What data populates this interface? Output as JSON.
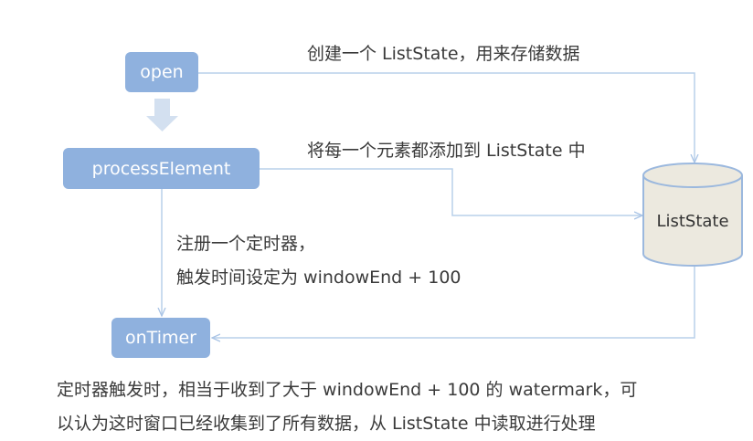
{
  "nodes": {
    "open": "open",
    "process": "processElement",
    "ontimer": "onTimer",
    "store": "ListState"
  },
  "edges": {
    "open_to_store": "创建一个 ListState，用来存储数据",
    "process_to_store": "将每一个元素都添加到 ListState 中",
    "process_to_ontimer_line1": "注册一个定时器，",
    "process_to_ontimer_line2": "触发时间设定为 windowEnd + 100"
  },
  "caption": {
    "line1": "定时器触发时，相当于收到了大于 windowEnd + 100 的 watermark，可",
    "line2": "以认为这时窗口已经收集到了所有数据，从 ListState 中读取进行处理"
  },
  "colors": {
    "box": "#8fb1de",
    "arrow": "#b9d0ea",
    "cylinder_fill": "#ece9df",
    "cylinder_stroke": "#9bb8de",
    "text": "#3a3a3a"
  }
}
